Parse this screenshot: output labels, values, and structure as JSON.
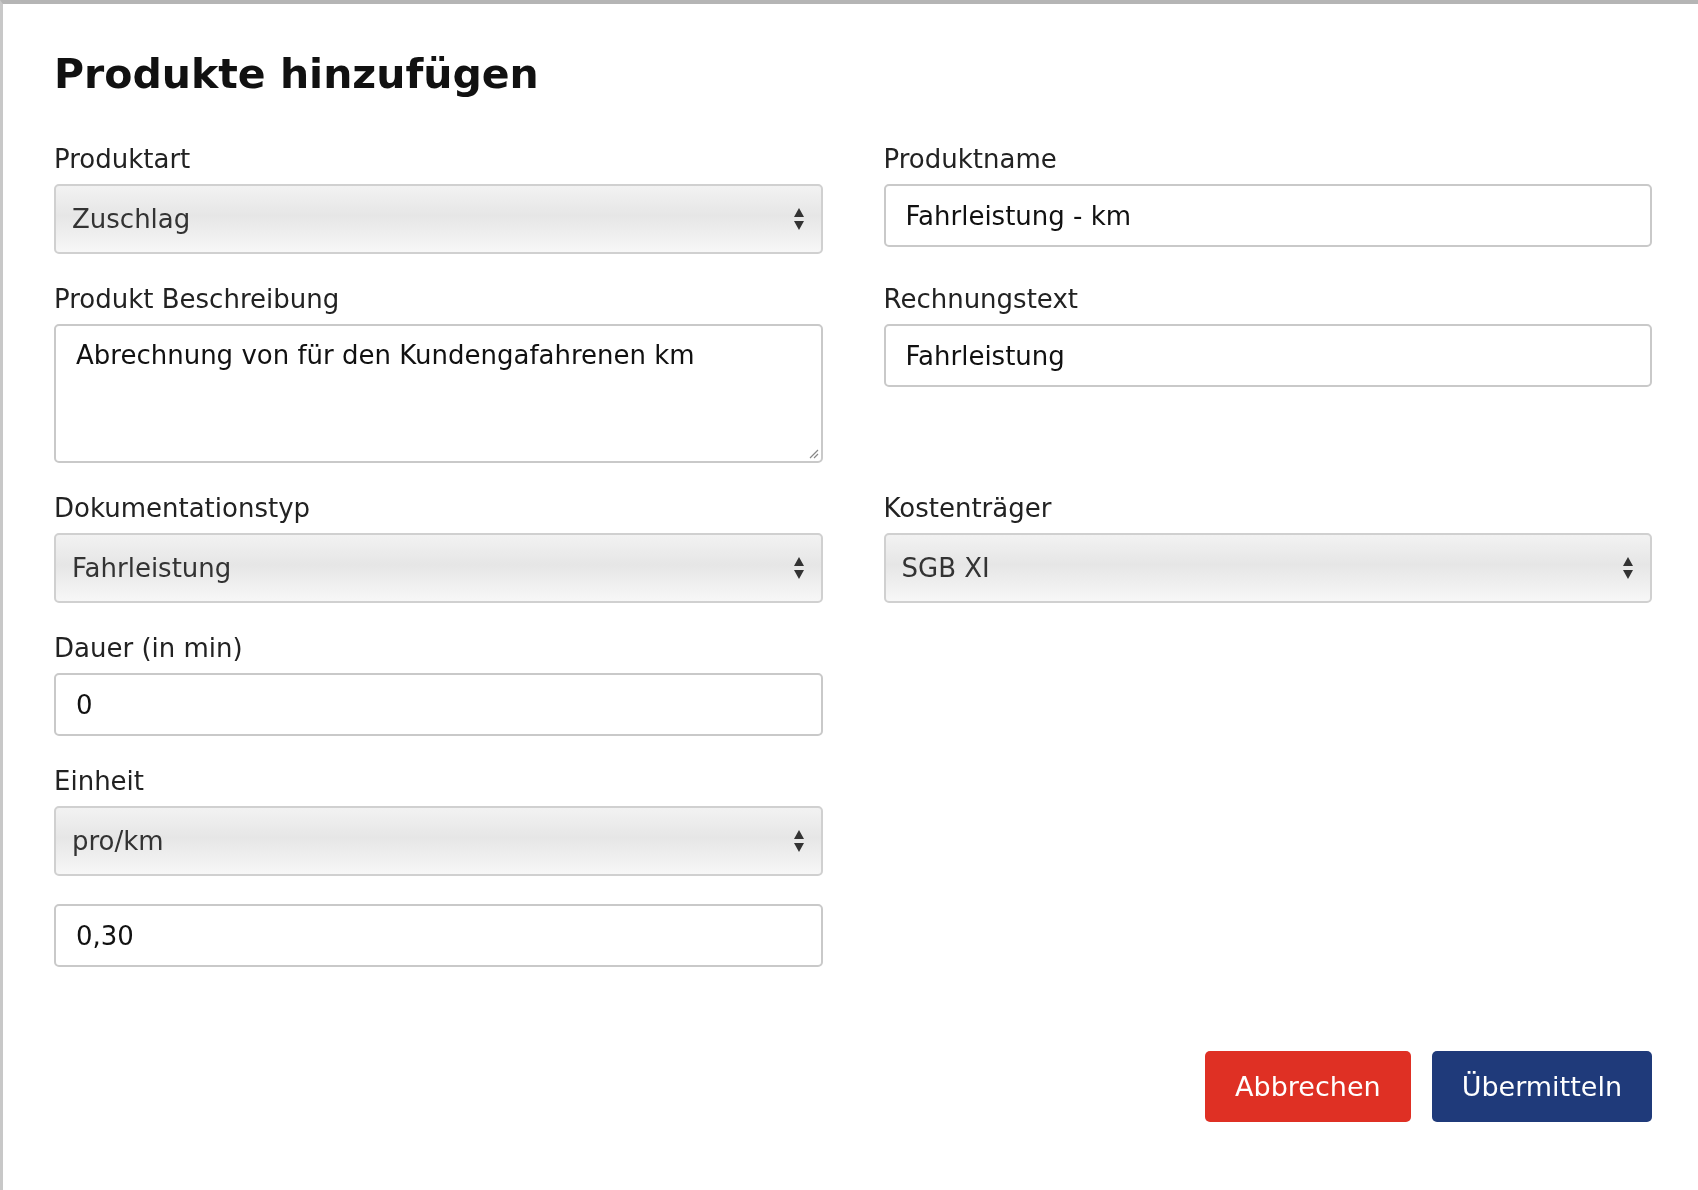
{
  "dialog": {
    "title": "Produkte hinzufügen",
    "rows": [
      [
        {
          "kind": "select",
          "label": "Produktart",
          "value": "Zuschlag"
        },
        {
          "kind": "input",
          "label": "Produktname",
          "value": "Fahrleistung - km"
        }
      ],
      [
        {
          "kind": "textarea",
          "label": "Produkt Beschreibung",
          "value": "Abrechnung von für den Kundengafahrenen km"
        },
        {
          "kind": "input",
          "label": "Rechnungstext",
          "value": "Fahrleistung"
        }
      ],
      [
        {
          "kind": "select",
          "label": "Dokumentationstyp",
          "value": "Fahrleistung"
        },
        {
          "kind": "select",
          "label": "Kostenträger",
          "value": "SGB XI"
        }
      ],
      [
        {
          "kind": "input",
          "label": "Dauer (in min)",
          "value": "0"
        }
      ],
      [
        {
          "kind": "select",
          "label": "Einheit",
          "value": "pro/km"
        }
      ],
      [
        {
          "kind": "input",
          "value": "0,30"
        }
      ]
    ],
    "buttons": [
      {
        "kind": "cancel",
        "label": "Abbrechen"
      },
      {
        "kind": "submit",
        "label": "Übermitteln"
      }
    ]
  }
}
